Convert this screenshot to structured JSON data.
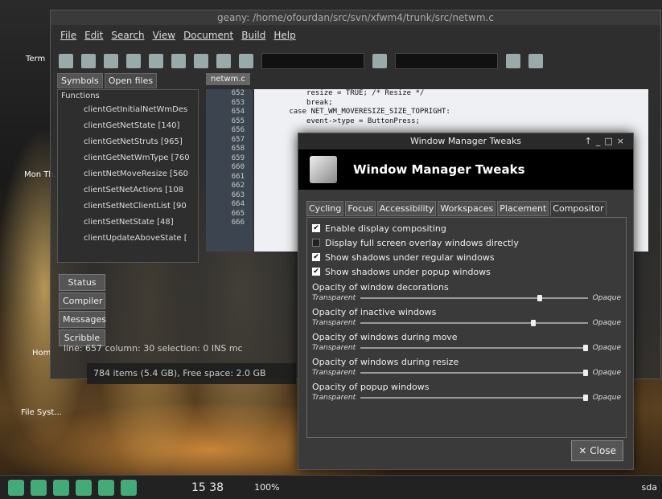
{
  "geany": {
    "title": "geany: /home/ofourdan/src/svn/xfwm4/trunk/src/netwm.c",
    "menu": [
      "File",
      "Edit",
      "Search",
      "View",
      "Document",
      "Build",
      "Help"
    ],
    "tabs": [
      "Symbols",
      "Open files"
    ],
    "symbols_header": "Functions",
    "symbols": [
      "clientGetInitialNetWmDes",
      "clientGetNetState [140]",
      "clientGetNetStruts [965]",
      "clientGetNetWmType [760",
      "clientNetMoveResize [560",
      "clientSetNetActions [108",
      "clientSetNetClientList [90",
      "clientSetNetState [48]",
      "clientUpdateAboveState ["
    ],
    "file_tab": "netwm.c",
    "line_numbers": [
      "652",
      "653",
      "654",
      "655",
      "656",
      "657",
      "658",
      "659",
      "660",
      "661",
      "662",
      "663",
      "664",
      "665",
      "666"
    ],
    "code": [
      "            resize = TRUE; /* Resize */",
      "            break;",
      "        case NET_WM_MOVERESIZE_SIZE_TOPRIGHT:",
      "            event->type = ButtonPress;"
    ],
    "bottom_tabs": [
      "Status",
      "Compiler",
      "Messages",
      "Scribble"
    ],
    "statusbar": "line: 657  column: 30  selection:  0  INS    mc"
  },
  "filemanager": {
    "status": "784 items (5.4 GB), Free space: 2.0 GB"
  },
  "desktop": {
    "icons": [
      "Term",
      "Mon Th...",
      "Hom",
      "File Syst..."
    ]
  },
  "dialog": {
    "titlebar": "Window Manager Tweaks",
    "header": "Window Manager Tweaks",
    "tabs": [
      "Cycling",
      "Focus",
      "Accessibility",
      "Workspaces",
      "Placement",
      "Compositor"
    ],
    "checks": [
      {
        "label": "Enable display compositing",
        "checked": true
      },
      {
        "label": "Display full screen overlay windows directly",
        "checked": false
      },
      {
        "label": "Show shadows under regular windows",
        "checked": true
      },
      {
        "label": "Show shadows under popup windows",
        "checked": true
      }
    ],
    "sliders": [
      {
        "label": "Opacity of window decorations",
        "value": 0.8
      },
      {
        "label": "Opacity of inactive windows",
        "value": 0.77
      },
      {
        "label": "Opacity of windows during move",
        "value": 1.0
      },
      {
        "label": "Opacity of windows during resize",
        "value": 1.0
      },
      {
        "label": "Opacity of popup windows",
        "value": 1.0
      }
    ],
    "low": "Transparent",
    "high": "Opaque",
    "close": "Close"
  },
  "taskbar": {
    "clock": "15 38",
    "battery": "100%",
    "user": "sda"
  }
}
